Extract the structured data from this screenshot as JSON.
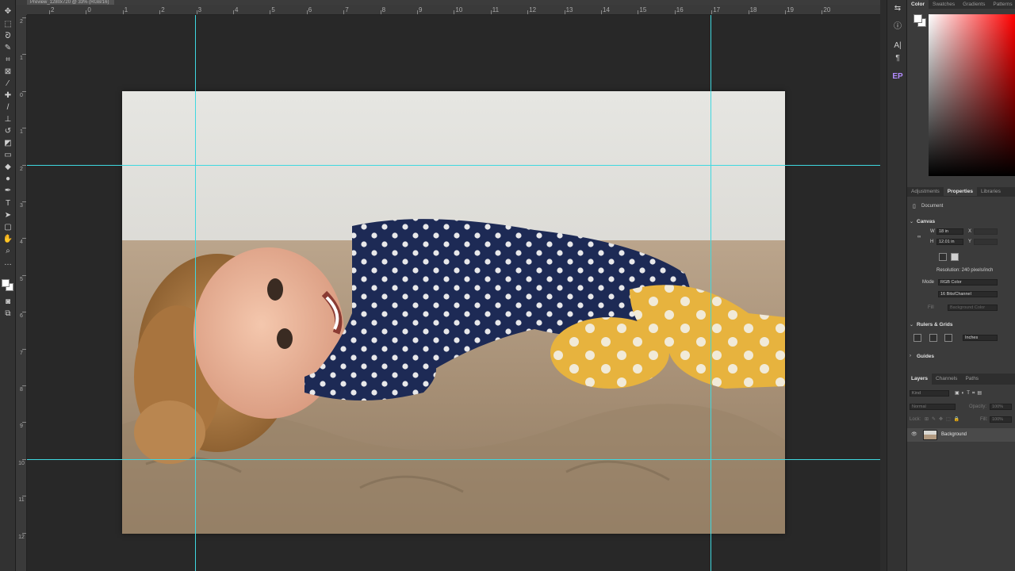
{
  "document_tab": {
    "title": "Preview_1280x720 @ 33% (RGB/16)"
  },
  "ruler_top": {
    "labels": [
      "2",
      "0",
      "1",
      "2",
      "3",
      "4",
      "5",
      "6",
      "7",
      "8",
      "9",
      "10",
      "11",
      "12",
      "13",
      "14",
      "15",
      "16",
      "17",
      "18",
      "19",
      "20"
    ]
  },
  "ruler_left": {
    "labels": [
      "2",
      "1",
      "0",
      "1",
      "2",
      "3",
      "4",
      "5",
      "6",
      "7",
      "8",
      "9",
      "10",
      "11",
      "12"
    ]
  },
  "toolbar": {
    "tools": [
      "move-tool",
      "marquee-tool",
      "lasso-tool",
      "quick-select-tool",
      "crop-tool",
      "frame-tool",
      "eyedropper-tool",
      "healing-brush-tool",
      "brush-tool",
      "clone-stamp-tool",
      "history-brush-tool",
      "eraser-tool",
      "gradient-tool",
      "blur-tool",
      "dodge-tool",
      "pen-tool",
      "type-tool",
      "path-select-tool",
      "rectangle-tool",
      "hand-tool",
      "zoom-tool",
      "more-tools"
    ]
  },
  "icon_column": {
    "icons": [
      "history-icon",
      "info-icon",
      "character-icon",
      "paragraph-icon",
      "plugin-ep-icon"
    ],
    "ep_label": "EP",
    "character_label": "A|",
    "paragraph_label": "¶"
  },
  "color_panel": {
    "tabs": [
      "Color",
      "Swatches",
      "Gradients",
      "Patterns"
    ],
    "active_tab": "Color",
    "hue_color": "#ff0000"
  },
  "properties_panel": {
    "tabs": [
      "Adjustments",
      "Properties",
      "Libraries"
    ],
    "active_tab": "Properties",
    "type_label": "Document",
    "canvas": {
      "title": "Canvas",
      "w_label": "W",
      "w_value": "18 in",
      "h_label": "H",
      "h_value": "12.01 in",
      "x_label": "X",
      "y_label": "Y",
      "resolution": "Resolution: 240 pixels/inch",
      "mode_label": "Mode",
      "mode_value": "RGB Color",
      "bits_value": "16 Bits/Channel",
      "fill_label": "Fill",
      "fill_value": "Background Color"
    },
    "rulers_grids": {
      "title": "Rulers & Grids",
      "units_value": "Inches"
    },
    "guides": {
      "title": "Guides"
    }
  },
  "layers_panel": {
    "tabs": [
      "Layers",
      "Channels",
      "Paths"
    ],
    "active_tab": "Layers",
    "kind_placeholder": "Kind",
    "blend_mode": "Normal",
    "opacity_label": "Opacity:",
    "opacity_value": "100%",
    "lock_label": "Lock:",
    "fill_label": "Fill:",
    "fill_value": "100%",
    "layers": [
      {
        "name": "Background",
        "visible": true
      }
    ]
  },
  "guides": {
    "horizontal_positions_in": [
      2,
      10
    ],
    "vertical_positions_in": [
      2,
      16
    ],
    "color": "#3fd8e0"
  },
  "photo": {
    "subject": "child-lying-on-sand"
  }
}
